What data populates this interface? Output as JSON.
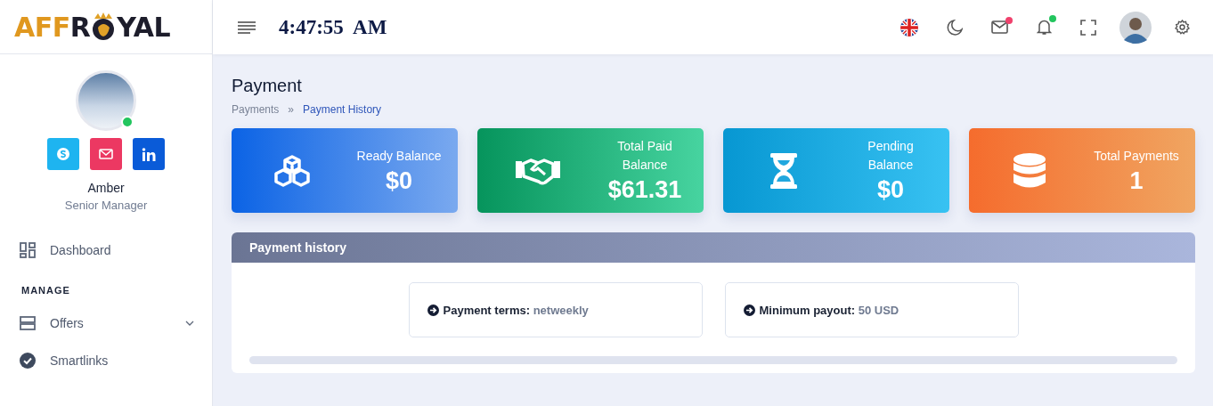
{
  "logo": {
    "accent": "AFF",
    "middle": "R",
    "end": "YAL"
  },
  "clock": "4:47:55  AM",
  "header_icons": [
    {
      "kind": "flag"
    },
    {
      "kind": "moon"
    },
    {
      "kind": "mail",
      "color": "#f0416c"
    },
    {
      "kind": "bell",
      "color": "#22c55e"
    },
    {
      "kind": "fullscreen"
    },
    {
      "kind": "avatar"
    },
    {
      "kind": "settings"
    }
  ],
  "profile": {
    "name": "Amber",
    "role": "Senior Manager",
    "online": true,
    "socials": [
      {
        "kind": "skype"
      },
      {
        "kind": "mail"
      },
      {
        "kind": "linkedin"
      }
    ]
  },
  "sidebar": {
    "items": [
      {
        "kind": "link",
        "label": "Dashboard"
      },
      {
        "kind": "heading",
        "label": "MANAGE"
      },
      {
        "kind": "submenu",
        "label": "Offers",
        "expanded": false
      },
      {
        "kind": "link",
        "label": "Smartlinks"
      }
    ]
  },
  "page": {
    "title": "Payment",
    "breadcrumb": [
      {
        "label": "Payments",
        "selected": false
      },
      {
        "label": "Payment History",
        "selected": true
      }
    ],
    "separator": "»"
  },
  "stats": [
    {
      "kind": "boxes",
      "label": "Ready Balance",
      "value": "$0"
    },
    {
      "kind": "handshake",
      "label": "Total Paid Balance",
      "value": "$61.31"
    },
    {
      "kind": "hourglass",
      "label": "Pending Balance",
      "value": "$0"
    },
    {
      "kind": "database",
      "label": "Total Payments",
      "value": "1"
    }
  ],
  "payment_history": {
    "title": "Payment history",
    "info": [
      {
        "label": "Payment terms:",
        "value": "netweekly"
      },
      {
        "label": "Minimum payout:",
        "value": "50 USD"
      }
    ]
  }
}
